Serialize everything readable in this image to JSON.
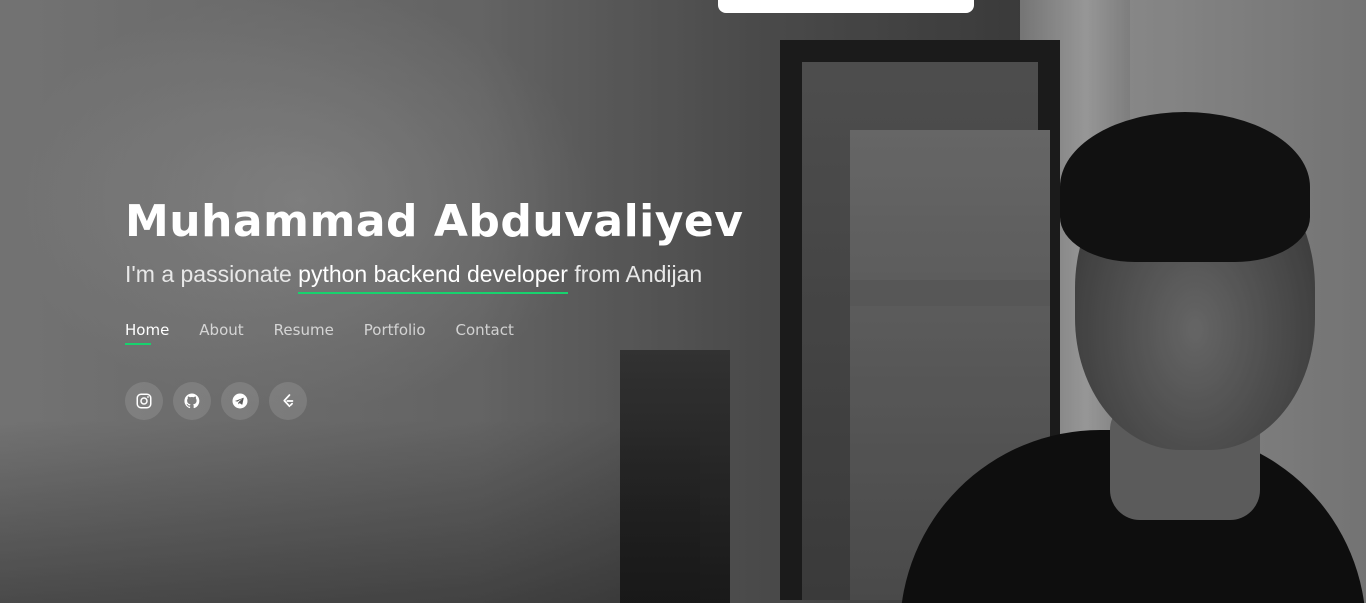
{
  "hero": {
    "name": "Muhammad Abduvaliyev",
    "tagline": {
      "prefix": "I'm a passionate ",
      "highlight": "python backend developer",
      "suffix": " from Andijan"
    },
    "accent_color": "#18d26e"
  },
  "nav": {
    "items": [
      {
        "label": "Home",
        "active": true
      },
      {
        "label": "About",
        "active": false
      },
      {
        "label": "Resume",
        "active": false
      },
      {
        "label": "Portfolio",
        "active": false
      },
      {
        "label": "Contact",
        "active": false
      }
    ]
  },
  "social": {
    "icons": [
      "instagram-icon",
      "github-icon",
      "telegram-icon",
      "leetcode-icon"
    ]
  }
}
